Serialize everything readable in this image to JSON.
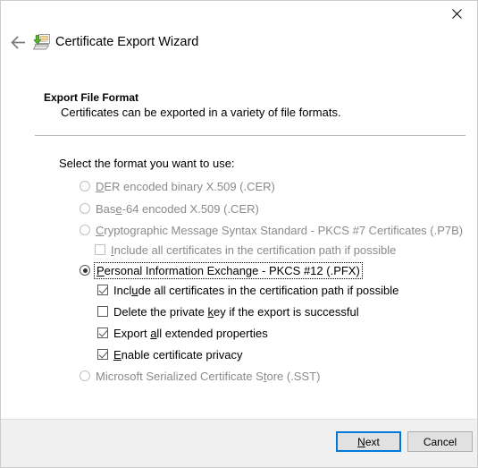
{
  "window": {
    "title": "Certificate Export Wizard",
    "icon": "certificate-export-icon",
    "close_label": "✕",
    "back_label": "←"
  },
  "header": {
    "title": "Export File Format",
    "subtitle": "Certificates can be exported in a variety of file formats."
  },
  "main": {
    "prompt": "Select the format you want to use:",
    "options": [
      {
        "id": "der",
        "type": "radio",
        "label_pre": "",
        "label_accel": "D",
        "label_post": "ER encoded binary X.509 (.CER)",
        "full_label": "DER encoded binary X.509 (.CER)",
        "checked": false,
        "disabled": true,
        "focused": false
      },
      {
        "id": "base64",
        "type": "radio",
        "label_pre": "Bas",
        "label_accel": "e",
        "label_post": "-64 encoded X.509 (.CER)",
        "full_label": "Base-64 encoded X.509 (.CER)",
        "checked": false,
        "disabled": true,
        "focused": false
      },
      {
        "id": "p7b",
        "type": "radio",
        "label_pre": "",
        "label_accel": "C",
        "label_post": "ryptographic Message Syntax Standard - PKCS #7 Certificates (.P7B)",
        "full_label": "Cryptographic Message Syntax Standard - PKCS #7 Certificates (.P7B)",
        "checked": false,
        "disabled": true,
        "focused": false
      },
      {
        "id": "p7b-include-chain",
        "type": "checkbox",
        "label_pre": "",
        "label_accel": "I",
        "label_post": "nclude all certificates in the certification path if possible",
        "full_label": "Include all certificates in the certification path if possible",
        "checked": false,
        "disabled": true,
        "focused": false
      },
      {
        "id": "pfx",
        "type": "radio",
        "label_pre": "",
        "label_accel": "P",
        "label_post": "ersonal Information Exchange - PKCS #12 (.PFX)",
        "full_label": "Personal Information Exchange - PKCS #12 (.PFX)",
        "checked": true,
        "disabled": false,
        "focused": true
      },
      {
        "id": "pfx-include-chain",
        "type": "checkbox",
        "label_pre": "Incl",
        "label_accel": "u",
        "label_post": "de all certificates in the certification path if possible",
        "full_label": "Include all certificates in the certification path if possible",
        "checked": true,
        "disabled": false,
        "focused": false
      },
      {
        "id": "delete-private-key",
        "type": "checkbox",
        "label_pre": "Delete the private ",
        "label_accel": "k",
        "label_post": "ey if the export is successful",
        "full_label": "Delete the private key if the export is successful",
        "checked": false,
        "disabled": false,
        "focused": false
      },
      {
        "id": "export-extended-properties",
        "type": "checkbox",
        "label_pre": "Export ",
        "label_accel": "a",
        "label_post": "ll extended properties",
        "full_label": "Export all extended properties",
        "checked": true,
        "disabled": false,
        "focused": false
      },
      {
        "id": "enable-certificate-privacy",
        "type": "checkbox",
        "label_pre": "",
        "label_accel": "E",
        "label_post": "nable certificate privacy",
        "full_label": "Enable certificate privacy",
        "checked": true,
        "disabled": false,
        "focused": false
      },
      {
        "id": "sst",
        "type": "radio",
        "label_pre": "Microsoft Serialized Certificate S",
        "label_accel": "t",
        "label_post": "ore (.SST)",
        "full_label": "Microsoft Serialized Certificate Store (.SST)",
        "checked": false,
        "disabled": true,
        "focused": false
      }
    ]
  },
  "footer": {
    "next_pre": "",
    "next_accel": "N",
    "next_post": "ext",
    "next_label": "Next",
    "cancel_label": "Cancel",
    "default_button_color": "#0078d7"
  }
}
